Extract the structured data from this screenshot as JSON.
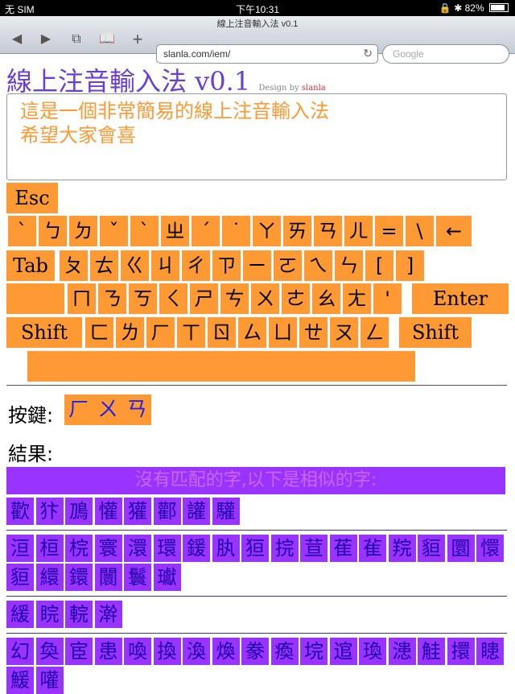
{
  "status": {
    "carrier": "无 SIM",
    "time": "下午10:31",
    "battery": "82%"
  },
  "browser": {
    "title": "線上注音輸入法 v0.1",
    "url": "slanla.com/iem/",
    "search_placeholder": "Google"
  },
  "page": {
    "heading": "線上注音輸入法 v0.1",
    "design_prefix": "Design by",
    "design_author": "slanla"
  },
  "textarea_value": "這是一個非常簡易的線上注音輸入法\n希望大家會喜",
  "keyboard": {
    "esc": "Esc",
    "row1": [
      "`",
      "ㄅ",
      "ㄉ",
      "ˇ",
      "ˋ",
      "ㄓ",
      "ˊ",
      "˙",
      "ㄚ",
      "ㄞ",
      "ㄢ",
      "ㄦ",
      "=",
      "\\",
      "←"
    ],
    "row2_label": "Tab",
    "row2": [
      "ㄆ",
      "ㄊ",
      "ㄍ",
      "ㄐ",
      "ㄔ",
      "ㄗ",
      "ㄧ",
      "ㄛ",
      "ㄟ",
      "ㄣ",
      "[",
      "]"
    ],
    "row3": [
      "ㄇ",
      "ㄋ",
      "ㄎ",
      "ㄑ",
      "ㄕ",
      "ㄘ",
      "ㄨ",
      "ㄜ",
      "ㄠ",
      "ㄤ",
      "'"
    ],
    "row3_enter": "Enter",
    "shift": "Shift",
    "row4": [
      "ㄈ",
      "ㄌ",
      "ㄏ",
      "ㄒ",
      "ㄖ",
      "ㄙ",
      "ㄩ",
      "ㄝ",
      "ㄡ",
      "ㄥ"
    ]
  },
  "keys_label": "按鍵:",
  "pressed_keys": [
    "ㄏ",
    "ㄨ",
    "ㄢ"
  ],
  "result_label": "結果:",
  "no_match_message": "沒有匹配的字,以下是相似的字:",
  "candidate_groups": [
    [
      "歡",
      "犿",
      "鳭",
      "懽",
      "獾",
      "酄",
      "讙",
      "驩"
    ],
    [
      "洹",
      "桓",
      "梡",
      "寰",
      "澴",
      "環",
      "鍰",
      "肒",
      "狟",
      "捖",
      "荁",
      "萑",
      "雈",
      "羦",
      "貆",
      "圜",
      "懁",
      "貆",
      "繯",
      "鐶",
      "闤",
      "鬟",
      "瓛"
    ],
    [
      "緩",
      "睆",
      "輐",
      "澣"
    ],
    [
      "幻",
      "奐",
      "宦",
      "患",
      "喚",
      "換",
      "渙",
      "煥",
      "豢",
      "瘓",
      "垸",
      "逭",
      "瑍",
      "漶",
      "觟",
      "擐",
      "瞣",
      "鰀",
      "嚾"
    ]
  ]
}
